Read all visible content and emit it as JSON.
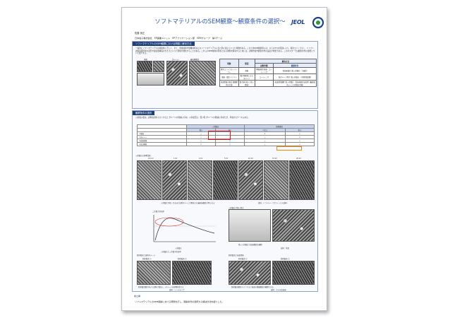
{
  "poster": {
    "title": "ソフトマテリアルのSEM観察～観察条件の選択～",
    "logo": "JEOL",
    "author": "佐藤 良正",
    "affiliation": "日本電子株式会社　EP事業ユニット　EPアプリケーション部　SEMグループ　第1チーム"
  },
  "section1": {
    "heading": "ソフトマテリアルのSEM観察における問題と解決方法",
    "text": "一般的にソフトマテリアルは導電性に乏しく、また、金属材料や無機材料などのハードマテリアルに比べ熱に弱いといった特徴がある。このためSEM観察時には、以下の3つの原因により、異常コントラスト、ドリフト、試料表面形状の変形や最表層構造の大きさといった現象が発生することがある。これらのSEM観察の障害となる現象を解決するためには、試料作製や観察条件の設定が重要である。このポスターでは観察条件の選択について紹介する。",
    "images": {
      "label_charge": "帯電",
      "label_damage": "ダメージ",
      "label_reflect": "最表層構造"
    },
    "table": {
      "col_phenomenon": "現象",
      "col_cause": "原因",
      "col_solution": "解決方法",
      "col_prep": "試料作製",
      "col_cond": "観察条件",
      "rows": [
        {
          "phenomenon": "異常コントラスト ドリフト",
          "cause": "帯電",
          "prep": "導電処理 (蒸着・コーティング)",
          "cond": "低加速電圧 (低入射電圧・大電流)"
        },
        {
          "phenomenon": "収縮・変形 ドリフト",
          "cause": "電子線照射による ダメージ",
          "prep": "コーティング",
          "cond": "低ダメージ条件 (低入射電圧・小照射電流量)"
        },
        {
          "phenomenon": "表面情報の喪失 微細構造の欠落",
          "cause": "電子線の侵入 (深い情報)",
          "prep": "",
          "cond": "表面形状観察 (低入射電圧・低加速電圧を使用) (最表層ダメージの有無を考慮)"
        }
      ]
    }
  },
  "section2": {
    "heading": "観察条件の選択",
    "text": "入射電子量は、試料電流を小さくすると ダメージの軽減に有効。入射電圧は、低い程 ダメージの軽減に有効だが、帯電するケースもある。",
    "table": {
      "header_col1": "入射電圧",
      "header_col2": "照射電流",
      "sub_low": "低い",
      "sub_high": "高い",
      "sub_small": "少ない",
      "sub_large": "多い",
      "rows": [
        {
          "label": "①帯電",
          "v": [
            "△",
            "○",
            "×",
            "○"
          ]
        },
        {
          "label": "②ダメージ",
          "v": [
            "○",
            "△",
            "○",
            "×"
          ]
        },
        {
          "label": "③表面情報",
          "v": [
            "○",
            "×",
            "△",
            "○"
          ]
        },
        {
          "label": "④高分解能",
          "v": [
            "×",
            "○",
            "△",
            "○"
          ]
        }
      ]
    },
    "strip": {
      "label": "入射電圧の影響比較",
      "voltages": [
        "0.5 kV",
        "1 kV",
        "2 kV",
        "5 kV",
        "10 kV",
        "15 kV",
        "20 kV"
      ],
      "caption": "入射電圧が低くなるほど試料ダメージが軽減され最表面構造が得られる",
      "sample": "試料：ドライヤー（セラミックス試料）"
    },
    "graph": {
      "ylabel": "二次電子放出率",
      "xlabel": "入射電圧",
      "note": "入射電圧と二次電子放出率"
    },
    "right_images": {
      "label_top": "入射電圧が低い場合",
      "caption_top": "低い入射電圧で表面構造を観察",
      "sample_top": "試料：毛髪"
    },
    "bottom_left": {
      "label": "照射電流と試料ダメージ",
      "sub1": "照射電流 小",
      "sub2": "照射電流 大",
      "caption": "照射電流量が多いと試料が変形し、ダメージの影響を受ける",
      "sample": "試料：ソールテープ"
    },
    "bottom_right": {
      "label": "照射電流と表面情報",
      "sub1": "照射電流 小",
      "sub2": "照射電流 大",
      "caption": "照射電流量を小さくすると表面の微細構造が観察できる",
      "sample": "試料：カヤの実表面"
    }
  },
  "summary": {
    "heading": "まとめ",
    "text": "ソフトマテリアルのSEM観察における問題を示し、観察条件の選択から解決方法を紹介した。"
  },
  "colors": {
    "title": "#2b55a8",
    "header_bar": "#1f3f7a",
    "highlight_red": "#e02020",
    "highlight_orange": "#f08a00"
  }
}
